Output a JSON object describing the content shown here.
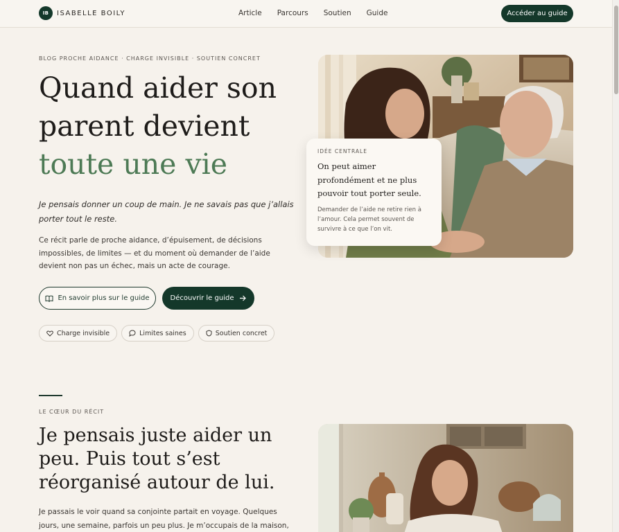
{
  "brand": {
    "initials": "IB",
    "name": "ISABELLE BOILY"
  },
  "nav": {
    "items": [
      "Article",
      "Parcours",
      "Soutien",
      "Guide"
    ]
  },
  "header": {
    "cta_label": "Accéder au guide"
  },
  "hero": {
    "eyebrow": "BLOG PROCHE AIDANCE · CHARGE INVISIBLE · SOUTIEN CONCRET",
    "title_line1": "Quand aider son",
    "title_line2": "parent devient",
    "title_accent": "toute une vie",
    "lead": "Je pensais donner un coup de main. Je ne savais pas que j’allais porter tout le reste.",
    "body": "Ce récit parle de proche aidance, d’épuisement, de décisions impossibles, de limites — et du moment où demander de l’aide devient non pas un échec, mais un acte de courage.",
    "btn_outline_label": "En savoir plus sur le guide",
    "btn_solid_label": "Découvrir le guide",
    "chips": [
      "Charge invisible",
      "Limites saines",
      "Soutien concret"
    ]
  },
  "quote_card": {
    "label": "IDÉE CENTRALE",
    "quote": "On peut aimer profondément et ne plus pouvoir tout porter seule.",
    "note": "Demander de l’aide ne retire rien à l’amour. Cela permet souvent de survivre à ce que l’on vit."
  },
  "section2": {
    "eyebrow": "LE CŒUR DU RÉCIT",
    "title": "Je pensais juste aider un peu. Puis tout s’est réorganisé autour de lui.",
    "body": "Je passais le voir quand sa conjointe partait en voyage. Quelques jours, une semaine, parfois un peu plus. Je m’occupais de la maison, je remplissais le"
  },
  "colors": {
    "accent_dark": "#14382a",
    "accent_green": "#4d7a55",
    "background": "#f6f2ec"
  },
  "icons": [
    "book-icon",
    "arrow-right-icon",
    "heart-icon",
    "chat-icon",
    "shield-icon"
  ]
}
